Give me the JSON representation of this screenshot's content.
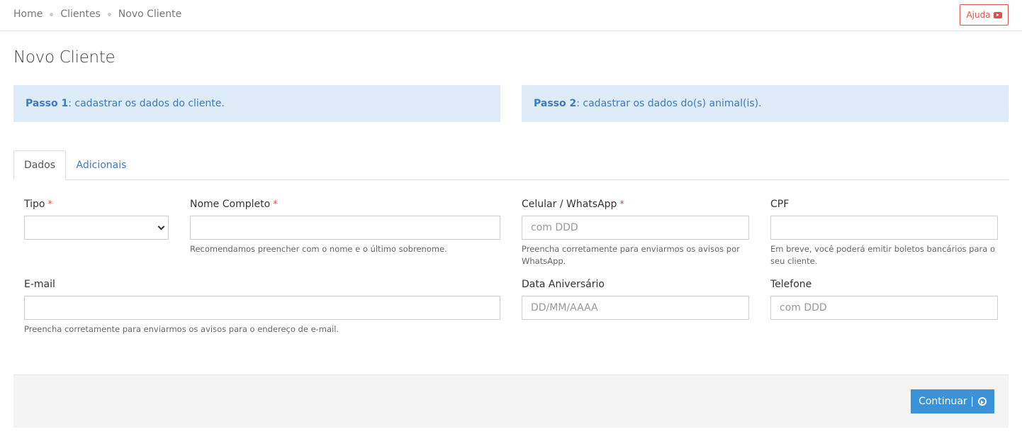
{
  "breadcrumb": {
    "items": [
      "Home",
      "Clientes",
      "Novo Cliente"
    ]
  },
  "help_button": {
    "label": "Ajuda",
    "icon": "youtube-play-icon"
  },
  "page": {
    "title": "Novo Cliente"
  },
  "steps": [
    {
      "title": "Passo 1",
      "text": ": cadastrar os dados do cliente."
    },
    {
      "title": "Passo 2",
      "text": ": cadastrar os dados do(s) animal(is)."
    }
  ],
  "tabs": [
    {
      "label": "Dados",
      "active": true
    },
    {
      "label": "Adicionais",
      "active": false
    }
  ],
  "form": {
    "tipo": {
      "label": "Tipo",
      "required_mark": "*",
      "value": ""
    },
    "nome": {
      "label": "Nome Completo",
      "required_mark": "*",
      "value": "",
      "help": "Recomendamos preencher com o nome e o último sobrenome."
    },
    "celular": {
      "label": "Celular / WhatsApp",
      "required_mark": "*",
      "placeholder": "com DDD",
      "help": "Preencha corretamente para enviarmos os avisos por WhatsApp."
    },
    "cpf": {
      "label": "CPF",
      "value": "",
      "help": "Em breve, você poderá emitir boletos bancários para o seu cliente."
    },
    "email": {
      "label": "E-mail",
      "value": "",
      "help": "Preencha corretamente para enviarmos os avisos para o endereço de e-mail."
    },
    "aniversario": {
      "label": "Data Aniversário",
      "placeholder": "DD/MM/AAAA"
    },
    "telefone": {
      "label": "Telefone",
      "placeholder": "com DDD"
    }
  },
  "footer": {
    "continue_label": "Continuar |",
    "continue_icon": "arrow-circle-right-icon"
  },
  "colors": {
    "primary": "#3a93d8",
    "link": "#3a7bc8",
    "danger": "#d9534f",
    "step_bg": "#deebf8"
  }
}
